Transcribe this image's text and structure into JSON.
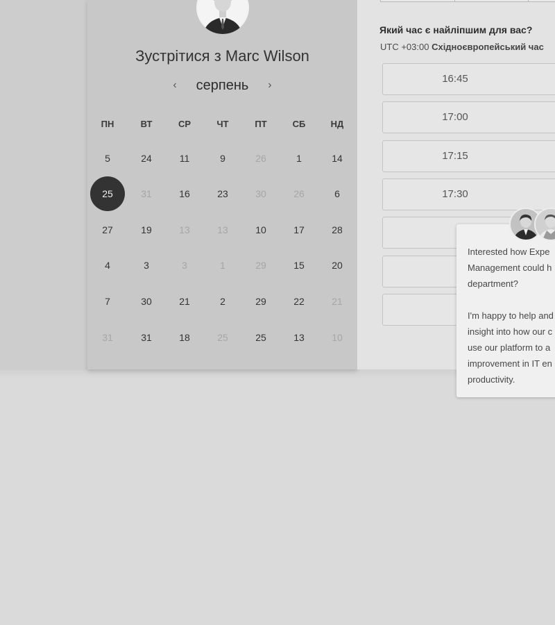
{
  "calendar": {
    "title": "Зустрітися з Marc Wilson",
    "month": "серпень",
    "prev_icon": "‹",
    "next_icon": "›",
    "weekdays": [
      "ПН",
      "ВТ",
      "СР",
      "ЧТ",
      "ПТ",
      "СБ",
      "НД"
    ],
    "weeks": [
      [
        {
          "d": "5"
        },
        {
          "d": "24"
        },
        {
          "d": "11"
        },
        {
          "d": "9"
        },
        {
          "d": "26",
          "dim": true
        },
        {
          "d": "1"
        },
        {
          "d": "14"
        }
      ],
      [
        {
          "d": "25",
          "sel": true
        },
        {
          "d": "31",
          "dim": true
        },
        {
          "d": "16"
        },
        {
          "d": "23"
        },
        {
          "d": "30",
          "dim": true
        },
        {
          "d": "26",
          "dim": true
        },
        {
          "d": "6"
        }
      ],
      [
        {
          "d": "27"
        },
        {
          "d": "19"
        },
        {
          "d": "13",
          "dim": true
        },
        {
          "d": "13",
          "dim": true
        },
        {
          "d": "10"
        },
        {
          "d": "17"
        },
        {
          "d": "28"
        }
      ],
      [
        {
          "d": "4"
        },
        {
          "d": "3"
        },
        {
          "d": "3",
          "dim": true
        },
        {
          "d": "1",
          "dim": true
        },
        {
          "d": "29",
          "dim": true
        },
        {
          "d": "15"
        },
        {
          "d": "20"
        }
      ],
      [
        {
          "d": "7"
        },
        {
          "d": "30"
        },
        {
          "d": "21"
        },
        {
          "d": "2"
        },
        {
          "d": "29"
        },
        {
          "d": "22"
        },
        {
          "d": "21",
          "dim": true
        }
      ],
      [
        {
          "d": "31",
          "dim": true
        },
        {
          "d": "31"
        },
        {
          "d": "18"
        },
        {
          "d": "25",
          "dim": true
        },
        {
          "d": "25"
        },
        {
          "d": "13"
        },
        {
          "d": "10",
          "dim": true
        }
      ]
    ]
  },
  "times": {
    "heading": "Який час є найліпшим для вас?",
    "tz_offset": "UTC +03:00",
    "tz_name": "Східноєвропейський час",
    "slots": [
      "16:45",
      "17:00",
      "17:15",
      "17:30",
      "",
      "",
      ""
    ]
  },
  "chat": {
    "paragraph1": "Interested how Experience Management could help your department?",
    "paragraph1_lines": [
      "Interested how Expe",
      "Management could h",
      "department?"
    ],
    "paragraph2_lines": [
      "I'm happy to help and",
      "insight into how our c",
      "use our platform to a",
      "improvement in IT en",
      "productivity."
    ]
  }
}
